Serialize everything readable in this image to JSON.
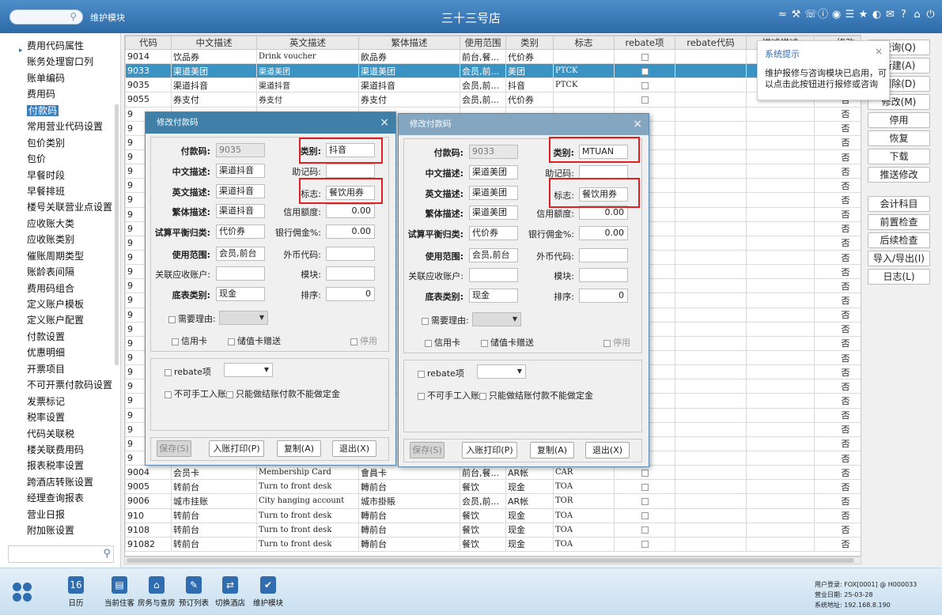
{
  "topbar": {
    "module": "维护模块",
    "hotel": "三十三号店",
    "icons": [
      "wifi-icon",
      "tools-icon",
      "phone-icon",
      "help-icon",
      "palette-icon",
      "menu-icon",
      "star-icon",
      "contrast-icon",
      "mail-icon",
      "question-icon",
      "home-icon",
      "power-icon"
    ]
  },
  "sidebar": {
    "items": [
      "费用代码属性",
      "账务处理窗口列",
      "账单编码",
      "费用码",
      "付款码",
      "常用营业代码设置",
      "包价类别",
      "包价",
      "早餐时段",
      "早餐排班",
      "楼号关联营业点设置",
      "应收账大类",
      "应收账类别",
      "催账周期类型",
      "账龄表间隔",
      "费用码组合",
      "定义账户模板",
      "定义账户配置",
      "付款设置",
      "优惠明细",
      "开票项目",
      "不可开票付款码设置",
      "发票标记",
      "税率设置",
      "代码关联税",
      "楼关联费用码",
      "报表税率设置",
      "跨酒店转账设置",
      "经理查询报表",
      "营业日报",
      "附加账设置"
    ],
    "active_index": 4
  },
  "grid": {
    "headers": [
      "代码",
      "中文描述",
      "英文描述",
      "繁体描述",
      "使用范围",
      "类别",
      "标志",
      "rebate项",
      "rebate代码",
      "描述描述",
      "修改"
    ],
    "rows": [
      [
        "9014",
        "饮品券",
        "Drink voucher",
        "飲品券",
        "前台,餐...",
        "代价券",
        "",
        "",
        "",
        "",
        "否"
      ],
      [
        "9033",
        "渠道美团",
        "渠道美团",
        "渠道美团",
        "会员,前...",
        "美团",
        "PTCK",
        "",
        "",
        "",
        "否"
      ],
      [
        "9035",
        "渠道抖音",
        "渠道抖音",
        "渠道抖音",
        "会员,前...",
        "抖音",
        "PTCK",
        "",
        "",
        "",
        "否"
      ],
      [
        "9055",
        "券支付",
        "券支付",
        "券支付",
        "会员,前...",
        "代价券",
        "",
        "",
        "",
        "",
        "否"
      ],
      [
        "9",
        "",
        "",
        "",
        "",
        "",
        "",
        "",
        "",
        "",
        "否"
      ],
      [
        "9",
        "",
        "",
        "",
        "",
        "",
        "",
        "",
        "",
        "",
        "否"
      ],
      [
        "9",
        "",
        "",
        "",
        "",
        "",
        "",
        "",
        "",
        "",
        "否"
      ],
      [
        "9",
        "",
        "",
        "",
        "",
        "",
        "",
        "",
        "",
        "",
        "否"
      ],
      [
        "9",
        "",
        "",
        "",
        "",
        "",
        "",
        "",
        "",
        "",
        "否"
      ],
      [
        "9",
        "",
        "",
        "",
        "",
        "",
        "",
        "",
        "",
        "",
        "否"
      ],
      [
        "9",
        "",
        "",
        "",
        "",
        "",
        "",
        "",
        "",
        "",
        "否"
      ],
      [
        "9",
        "",
        "",
        "",
        "",
        "",
        "",
        "",
        "",
        "",
        "否"
      ],
      [
        "9",
        "",
        "",
        "",
        "",
        "",
        "",
        "",
        "",
        "",
        "否"
      ],
      [
        "9",
        "",
        "",
        "",
        "",
        "",
        "",
        "",
        "",
        "",
        "否"
      ],
      [
        "9",
        "",
        "",
        "",
        "",
        "",
        "",
        "",
        "",
        "",
        "否"
      ],
      [
        "9",
        "",
        "",
        "",
        "",
        "",
        "",
        "",
        "",
        "",
        "否"
      ],
      [
        "9",
        "",
        "",
        "",
        "",
        "",
        "",
        "",
        "",
        "",
        "否"
      ],
      [
        "9",
        "",
        "",
        "",
        "",
        "",
        "",
        "",
        "",
        "",
        "否"
      ],
      [
        "9",
        "",
        "",
        "",
        "",
        "",
        "",
        "",
        "",
        "",
        "否"
      ],
      [
        "9",
        "",
        "",
        "",
        "",
        "",
        "",
        "",
        "",
        "",
        "否"
      ],
      [
        "9",
        "",
        "",
        "",
        "",
        "",
        "",
        "",
        "",
        "",
        "否"
      ],
      [
        "9",
        "",
        "",
        "",
        "",
        "",
        "",
        "",
        "",
        "",
        "否"
      ],
      [
        "9",
        "",
        "",
        "",
        "",
        "",
        "",
        "",
        "",
        "",
        "否"
      ],
      [
        "9",
        "",
        "",
        "",
        "",
        "",
        "",
        "",
        "",
        "",
        "否"
      ],
      [
        "9",
        "",
        "",
        "",
        "",
        "",
        "",
        "",
        "",
        "",
        "否"
      ],
      [
        "9",
        "",
        "",
        "",
        "",
        "",
        "",
        "",
        "",
        "",
        "否"
      ],
      [
        "9",
        "",
        "",
        "",
        "",
        "",
        "",
        "",
        "",
        "",
        "否"
      ],
      [
        "9",
        "",
        "",
        "",
        "",
        "",
        "",
        "",
        "",
        "",
        "否"
      ],
      [
        "9",
        "",
        "",
        "",
        "",
        "",
        "",
        "",
        "",
        "",
        "否"
      ],
      [
        "9004",
        "会员卡",
        "Membership Card",
        "會員卡",
        "前台,餐...",
        "AR帐",
        "CAR",
        "",
        "",
        "",
        "否"
      ],
      [
        "9005",
        "转前台",
        "Turn to front desk",
        "轉前台",
        "餐饮",
        "现金",
        "TOA",
        "",
        "",
        "",
        "否"
      ],
      [
        "9006",
        "城市挂账",
        "City hanging account",
        "城市掛賬",
        "会员,前...",
        "AR帐",
        "TOR",
        "",
        "",
        "",
        "否"
      ],
      [
        "910",
        "转前台",
        "Turn to front desk",
        "轉前台",
        "餐饮",
        "现金",
        "TOA",
        "",
        "",
        "",
        "否"
      ],
      [
        "9108",
        "转前台",
        "Turn to front desk",
        "轉前台",
        "餐饮",
        "现金",
        "TOA",
        "",
        "",
        "",
        "否"
      ],
      [
        "91082",
        "转前台",
        "Turn to front desk",
        "轉前台",
        "餐饮",
        "现金",
        "TOA",
        "",
        "",
        "",
        "否"
      ]
    ],
    "selected_row": 1
  },
  "buttons": {
    "group1": [
      "查询(Q)",
      "新建(A)",
      "删除(D)",
      "修改(M)",
      "停用",
      "恢复",
      "下载",
      "推送修改"
    ],
    "group2": [
      "会计科目",
      "前置检查",
      "后续检查",
      "导入/导出(I)",
      "日志(L)"
    ]
  },
  "tip": {
    "title": "系统提示",
    "body": "维护报修与咨询模块已启用，可以点击此按钮进行报修或咨询"
  },
  "labels": {
    "code": "付款码:",
    "cn": "中文描述:",
    "en": "英文描述:",
    "tw": "繁体描述:",
    "trial": "试算平衡归类:",
    "scope": "使用范围:",
    "ar": "关联应收账户:",
    "base": "底表类别:",
    "category": "类别:",
    "mnemonic": "助记码:",
    "flag": "标志:",
    "credit": "信用额度:",
    "commission": "银行佣金%:",
    "fx": "外币代码:",
    "block": "模块:",
    "sort": "排序:",
    "reason": "需要理由:",
    "card": "信用卡",
    "stored": "储值卡赠送",
    "stop": "停用",
    "rebate": "rebate项",
    "nomanual": "不可手工入账",
    "onlysettle": "只能做结账付款不能做定金"
  },
  "dlg_buttons": [
    "保存(S)",
    "入账打印(P)",
    "复制(A)",
    "退出(X)"
  ],
  "dialog1": {
    "title": "修改付款码",
    "code": "9035",
    "cn": "渠道抖音",
    "en": "渠道抖音",
    "tw": "渠道抖音",
    "trial": "代价券",
    "scope": "会员,前台",
    "ar": "",
    "base": "现金",
    "category": "抖音",
    "mnemonic": "",
    "flag": "餐饮用券",
    "credit": "0.00",
    "commission": "0.00",
    "fx": "",
    "block": "",
    "sort": "0"
  },
  "dialog2": {
    "title": "修改付款码",
    "code": "9033",
    "cn": "渠道美团",
    "en": "渠道美团",
    "tw": "渠道美团",
    "trial": "代价券",
    "scope": "会员,前台",
    "ar": "",
    "base": "现金",
    "category": "MTUAN",
    "mnemonic": "",
    "flag": "餐饮用券",
    "credit": "0.00",
    "commission": "0.00",
    "fx": "",
    "block": "",
    "sort": "0"
  },
  "taskbar": {
    "items": [
      "日历",
      "当前住客",
      "房务与查房",
      "预订列表",
      "切换酒店",
      "维护模块"
    ],
    "calendar_day": "16",
    "user": "用户登录: FOX[0001] @ H000033",
    "date": "营业日期: 25-03-28",
    "ip": "系统地址: 192.168.8.190"
  }
}
